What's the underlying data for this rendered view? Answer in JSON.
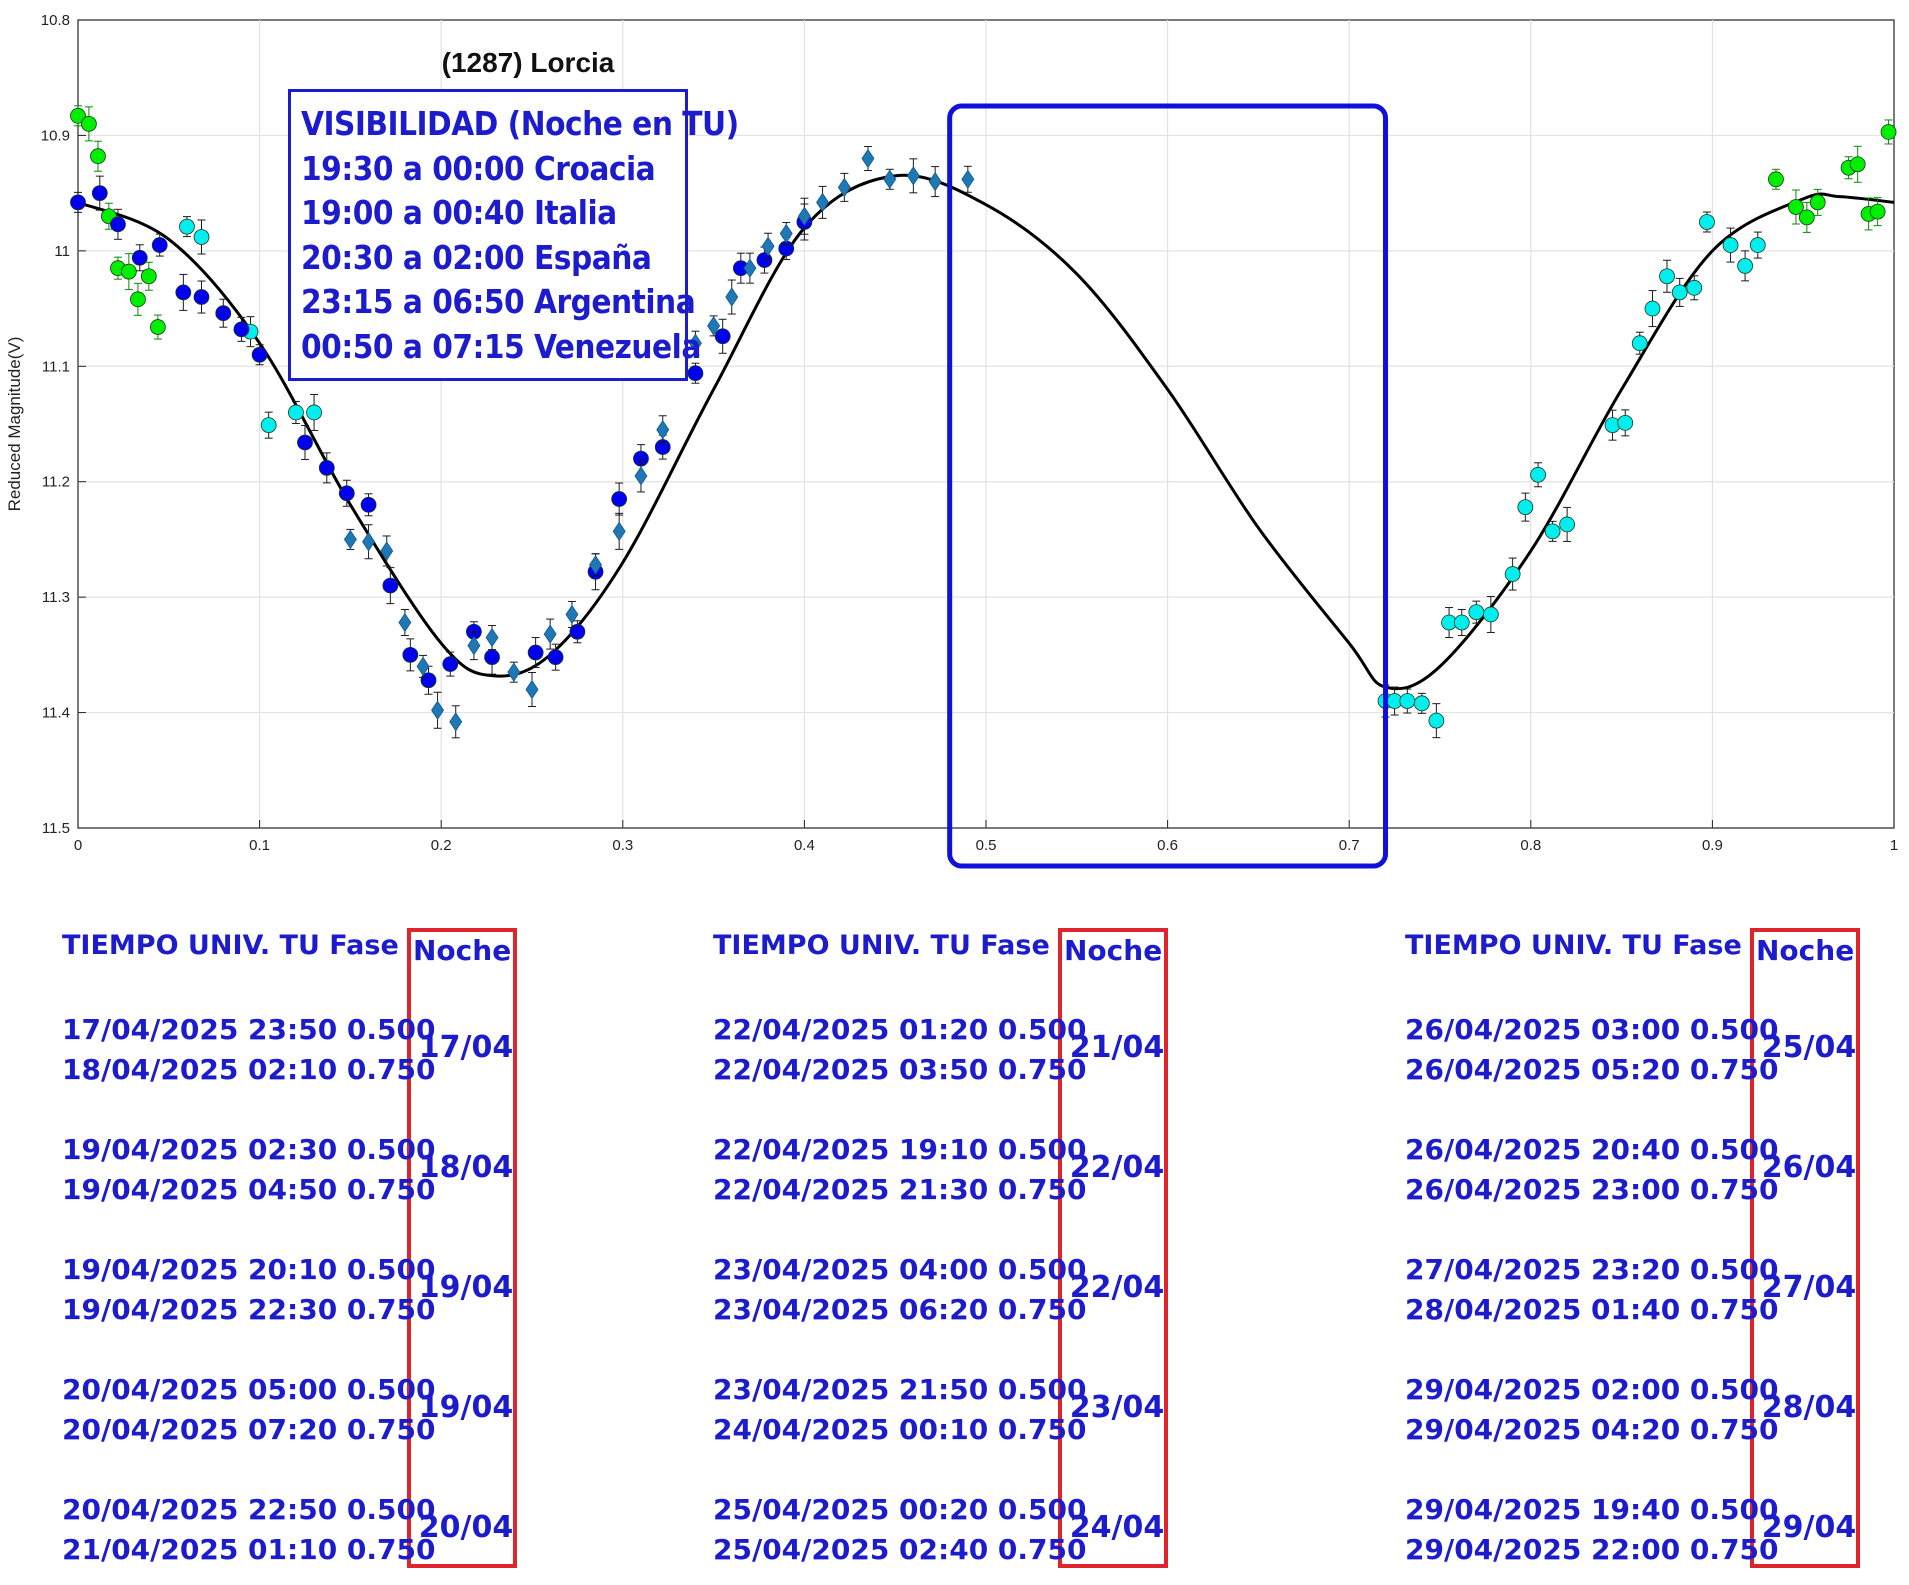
{
  "chart_data": {
    "type": "scatter",
    "title": "(1287) Lorcia",
    "xlabel": "",
    "ylabel": "Reduced Magnitude(V)",
    "xlim": [
      0,
      1
    ],
    "ylim": [
      11.5,
      10.8
    ],
    "y_reversed": true,
    "grid": true,
    "xticks": [
      "0",
      "0.1",
      "0.2",
      "0.3",
      "0.4",
      "0.5",
      "0.6",
      "0.7",
      "0.8",
      "0.9",
      "1"
    ],
    "yticks": [
      "10.8",
      "10.9",
      "11",
      "11.1",
      "11.2",
      "11.3",
      "11.4",
      "11.5"
    ],
    "fit_curve": {
      "color": "#000000",
      "points": [
        [
          0.0,
          10.958
        ],
        [
          0.05,
          10.99
        ],
        [
          0.1,
          11.08
        ],
        [
          0.15,
          11.22
        ],
        [
          0.2,
          11.34
        ],
        [
          0.228,
          11.368
        ],
        [
          0.26,
          11.35
        ],
        [
          0.3,
          11.27
        ],
        [
          0.35,
          11.12
        ],
        [
          0.4,
          10.98
        ],
        [
          0.45,
          10.935
        ],
        [
          0.5,
          10.96
        ],
        [
          0.55,
          11.02
        ],
        [
          0.6,
          11.12
        ],
        [
          0.65,
          11.24
        ],
        [
          0.7,
          11.34
        ],
        [
          0.72,
          11.378
        ],
        [
          0.75,
          11.36
        ],
        [
          0.8,
          11.26
        ],
        [
          0.85,
          11.12
        ],
        [
          0.9,
          11.0
        ],
        [
          0.95,
          10.955
        ],
        [
          0.97,
          10.953
        ],
        [
          1.0,
          10.958
        ]
      ]
    },
    "highlight_region": {
      "x": [
        0.48,
        0.72
      ],
      "color": "#1010dd"
    },
    "series": [
      {
        "marker": "circle",
        "color": "#00ee00",
        "errorbar_color": "#0a8a0a",
        "points": [
          [
            0.0,
            10.883
          ],
          [
            0.006,
            10.89
          ],
          [
            0.011,
            10.918
          ],
          [
            0.017,
            10.97
          ],
          [
            0.022,
            11.015
          ],
          [
            0.028,
            11.018
          ],
          [
            0.033,
            11.042
          ],
          [
            0.039,
            11.022
          ],
          [
            0.044,
            11.066
          ],
          [
            0.935,
            10.938
          ],
          [
            0.946,
            10.962
          ],
          [
            0.952,
            10.971
          ],
          [
            0.958,
            10.958
          ],
          [
            0.975,
            10.928
          ],
          [
            0.98,
            10.925
          ],
          [
            0.986,
            10.968
          ],
          [
            0.991,
            10.966
          ],
          [
            0.997,
            10.897
          ]
        ]
      },
      {
        "marker": "circle",
        "color": "#00eeee",
        "errorbar_color": "#1a1a1a",
        "points": [
          [
            0.06,
            10.979
          ],
          [
            0.068,
            10.988
          ],
          [
            0.095,
            11.07
          ],
          [
            0.105,
            11.151
          ],
          [
            0.12,
            11.14
          ],
          [
            0.13,
            11.14
          ],
          [
            0.72,
            11.39
          ],
          [
            0.725,
            11.39
          ],
          [
            0.732,
            11.39
          ],
          [
            0.74,
            11.392
          ],
          [
            0.748,
            11.407
          ],
          [
            0.755,
            11.322
          ],
          [
            0.762,
            11.322
          ],
          [
            0.77,
            11.313
          ],
          [
            0.778,
            11.315
          ],
          [
            0.79,
            11.28
          ],
          [
            0.797,
            11.222
          ],
          [
            0.804,
            11.194
          ],
          [
            0.812,
            11.243
          ],
          [
            0.82,
            11.237
          ],
          [
            0.845,
            11.151
          ],
          [
            0.852,
            11.149
          ],
          [
            0.86,
            11.08
          ],
          [
            0.867,
            11.05
          ],
          [
            0.875,
            11.022
          ],
          [
            0.882,
            11.036
          ],
          [
            0.89,
            11.032
          ],
          [
            0.897,
            10.975
          ],
          [
            0.91,
            10.995
          ],
          [
            0.918,
            11.013
          ],
          [
            0.925,
            10.995
          ]
        ]
      },
      {
        "marker": "circle",
        "color": "#0000ee",
        "errorbar_color": "#1a1a1a",
        "points": [
          [
            0.0,
            10.958
          ],
          [
            0.012,
            10.95
          ],
          [
            0.022,
            10.977
          ],
          [
            0.034,
            11.006
          ],
          [
            0.045,
            10.995
          ],
          [
            0.058,
            11.036
          ],
          [
            0.068,
            11.04
          ],
          [
            0.08,
            11.054
          ],
          [
            0.09,
            11.068
          ],
          [
            0.1,
            11.09
          ],
          [
            0.125,
            11.166
          ],
          [
            0.137,
            11.188
          ],
          [
            0.148,
            11.21
          ],
          [
            0.16,
            11.22
          ],
          [
            0.172,
            11.29
          ],
          [
            0.183,
            11.35
          ],
          [
            0.193,
            11.372
          ],
          [
            0.205,
            11.358
          ],
          [
            0.218,
            11.33
          ],
          [
            0.228,
            11.352
          ],
          [
            0.252,
            11.348
          ],
          [
            0.263,
            11.352
          ],
          [
            0.275,
            11.33
          ],
          [
            0.285,
            11.278
          ],
          [
            0.298,
            11.215
          ],
          [
            0.31,
            11.18
          ],
          [
            0.322,
            11.17
          ],
          [
            0.34,
            11.106
          ],
          [
            0.355,
            11.074
          ],
          [
            0.365,
            11.015
          ],
          [
            0.378,
            11.008
          ],
          [
            0.39,
            10.998
          ],
          [
            0.4,
            10.975
          ]
        ]
      },
      {
        "marker": "diamond",
        "color": "#1f77b4",
        "errorbar_color": "#1a1a1a",
        "points": [
          [
            0.15,
            11.25
          ],
          [
            0.16,
            11.252
          ],
          [
            0.17,
            11.26
          ],
          [
            0.18,
            11.322
          ],
          [
            0.19,
            11.36
          ],
          [
            0.198,
            11.398
          ],
          [
            0.208,
            11.408
          ],
          [
            0.218,
            11.342
          ],
          [
            0.228,
            11.335
          ],
          [
            0.24,
            11.365
          ],
          [
            0.25,
            11.38
          ],
          [
            0.26,
            11.332
          ],
          [
            0.272,
            11.315
          ],
          [
            0.285,
            11.272
          ],
          [
            0.298,
            11.243
          ],
          [
            0.31,
            11.195
          ],
          [
            0.322,
            11.155
          ],
          [
            0.34,
            11.08
          ],
          [
            0.35,
            11.065
          ],
          [
            0.36,
            11.04
          ],
          [
            0.37,
            11.015
          ],
          [
            0.38,
            10.996
          ],
          [
            0.39,
            10.985
          ],
          [
            0.4,
            10.97
          ],
          [
            0.41,
            10.958
          ],
          [
            0.422,
            10.945
          ],
          [
            0.435,
            10.92
          ],
          [
            0.447,
            10.938
          ],
          [
            0.46,
            10.935
          ],
          [
            0.472,
            10.94
          ],
          [
            0.49,
            10.938
          ]
        ]
      }
    ]
  },
  "visibility": {
    "lines": [
      "VISIBILIDAD (Noche en TU)",
      "19:30 a 00:00 Croacia",
      "19:00 a 00:40 Italia",
      "20:30 a 02:00 España",
      "23:15 a 06:50 Argentina",
      "00:50 a 07:15 Venezuela"
    ]
  },
  "tables": [
    {
      "header": "TIEMPO UNIV. TU   Fase",
      "noche_header": "Noche",
      "groups": [
        {
          "r1": "17/04/2025  23:50 0.500",
          "r2": "18/04/2025  02:10 0.750",
          "noche": "17/04"
        },
        {
          "r1": "19/04/2025  02:30 0.500",
          "r2": "19/04/2025  04:50 0.750",
          "noche": "18/04"
        },
        {
          "r1": "19/04/2025  20:10 0.500",
          "r2": "19/04/2025  22:30 0.750",
          "noche": "19/04"
        },
        {
          "r1": "20/04/2025  05:00 0.500",
          "r2": "20/04/2025  07:20 0.750",
          "noche": "19/04"
        },
        {
          "r1": "20/04/2025  22:50 0.500",
          "r2": "21/04/2025  01:10 0.750",
          "noche": "20/04"
        }
      ]
    },
    {
      "header": "TIEMPO UNIV. TU   Fase",
      "noche_header": "Noche",
      "groups": [
        {
          "r1": "22/04/2025  01:20 0.500",
          "r2": "22/04/2025  03:50 0.750",
          "noche": "21/04"
        },
        {
          "r1": "22/04/2025  19:10 0.500",
          "r2": "22/04/2025  21:30 0.750",
          "noche": "22/04"
        },
        {
          "r1": "23/04/2025  04:00 0.500",
          "r2": "23/04/2025  06:20 0.750",
          "noche": "22/04"
        },
        {
          "r1": "23/04/2025  21:50 0.500",
          "r2": "24/04/2025  00:10 0.750",
          "noche": "23/04"
        },
        {
          "r1": "25/04/2025  00:20 0.500",
          "r2": "25/04/2025  02:40 0.750",
          "noche": "24/04"
        }
      ]
    },
    {
      "header": "TIEMPO UNIV. TU   Fase",
      "noche_header": "Noche",
      "groups": [
        {
          "r1": "26/04/2025  03:00 0.500",
          "r2": "26/04/2025  05:20 0.750",
          "noche": "25/04"
        },
        {
          "r1": "26/04/2025  20:40 0.500",
          "r2": "26/04/2025  23:00 0.750",
          "noche": "26/04"
        },
        {
          "r1": "27/04/2025  23:20 0.500",
          "r2": "28/04/2025  01:40 0.750",
          "noche": "27/04"
        },
        {
          "r1": "29/04/2025  02:00 0.500",
          "r2": "29/04/2025  04:20 0.750",
          "noche": "28/04"
        },
        {
          "r1": "29/04/2025  19:40 0.500",
          "r2": "29/04/2025  22:00 0.750",
          "noche": "29/04"
        }
      ]
    }
  ]
}
